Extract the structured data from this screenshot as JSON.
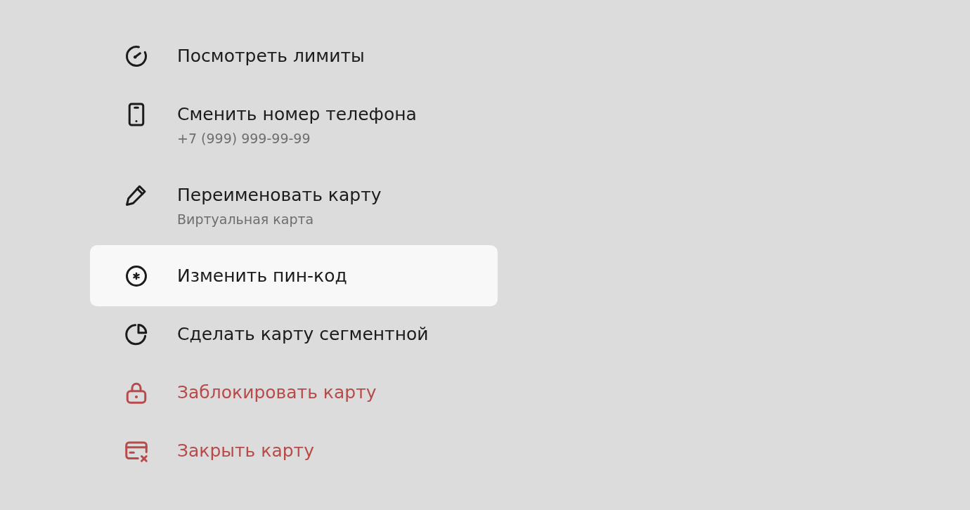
{
  "menu": {
    "items": [
      {
        "kind": "normal",
        "label": "Посмотреть лимиты",
        "selected": false
      },
      {
        "kind": "normal",
        "label": "Сменить номер телефона",
        "subtitle": "+7 (999) 999-99-99",
        "selected": false
      },
      {
        "kind": "normal",
        "label": "Переименовать карту",
        "subtitle": "Виртуальная карта",
        "selected": false
      },
      {
        "kind": "normal",
        "label": "Изменить пин-код",
        "selected": true
      },
      {
        "kind": "normal",
        "label": "Сделать карту сегментной",
        "selected": false
      },
      {
        "kind": "danger",
        "label": "Заблокировать карту",
        "selected": false
      },
      {
        "kind": "danger",
        "label": "Закрыть карту",
        "selected": false
      }
    ]
  }
}
